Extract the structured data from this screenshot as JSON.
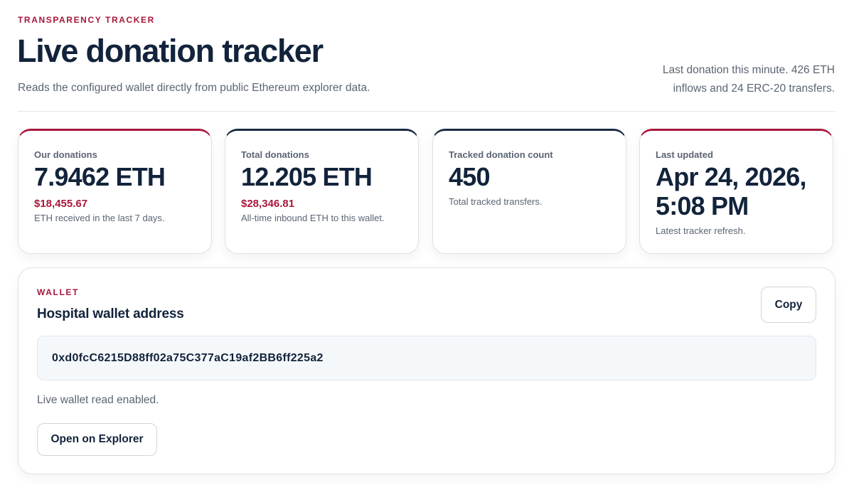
{
  "header": {
    "eyebrow": "TRANSPARENCY TRACKER",
    "title": "Live donation tracker",
    "subtitle": "Reads the configured wallet directly from public Ethereum explorer data.",
    "last_donation_line1": "Last donation this minute. 426 ETH",
    "last_donation_line2": "inflows and 24 ERC-20 transfers."
  },
  "stats": [
    {
      "label": "Our donations",
      "value": "7.9462 ETH",
      "usd": "$18,455.67",
      "note": "ETH received in the last 7 days.",
      "accent": "#a8173a"
    },
    {
      "label": "Total donations",
      "value": "12.205 ETH",
      "usd": "$28,346.81",
      "note": "All-time inbound ETH to this wallet.",
      "accent": "#1a2a44"
    },
    {
      "label": "Tracked donation count",
      "value": "450",
      "note": "Total tracked transfers.",
      "accent": "#1a2a44"
    },
    {
      "label": "Last updated",
      "value_line1": "Apr 24, 2026,",
      "value_line2": "5:08 PM",
      "note": "Latest tracker refresh.",
      "accent": "#a8173a"
    }
  ],
  "wallet": {
    "eyebrow": "WALLET",
    "title": "Hospital wallet address",
    "copy_label": "Copy",
    "address": "0xd0fcC6215D88ff02a75C377aC19af2BB6ff225a2",
    "status": "Live wallet read enabled.",
    "explorer_label": "Open on Explorer"
  },
  "colors": {
    "brand_red": "#a8173a",
    "navy": "#12233b",
    "muted": "#5b6573"
  }
}
